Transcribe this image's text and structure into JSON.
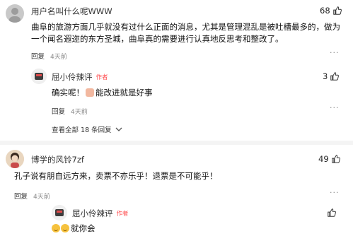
{
  "comments": [
    {
      "username": "用户名叫什么呢WWW",
      "likes": "68",
      "text": "曲阜的旅游方面几乎就没有过什么正面的消息，尤其是管理混乱是被吐槽最多的，做为一个闻名遐迩的东方圣城，曲阜真的需要进行认真地反思考和整改了。",
      "reply_label": "回复",
      "time": "4天前",
      "reply": {
        "username": "屈小伶辣评",
        "badge": "作者",
        "likes": "3",
        "text_before": "确实呢！",
        "text_after": "能改进就是好事",
        "reply_label": "回复",
        "time": "4天前"
      },
      "view_all": "查看全部 18 条回复"
    },
    {
      "username": "博学的风铃7zf",
      "likes": "49",
      "text": "孔子说有朋自远方来，卖票不亦乐乎！退票是不可能乎！",
      "reply_label": "回复",
      "time": "4天前",
      "reply": {
        "username": "屈小伶辣评",
        "badge": "作者",
        "text_after": "就你会"
      }
    }
  ],
  "icons": {
    "like": "thumbs-up-icon",
    "more": "more-dots-icon",
    "chevron": "chevron-down-icon"
  }
}
